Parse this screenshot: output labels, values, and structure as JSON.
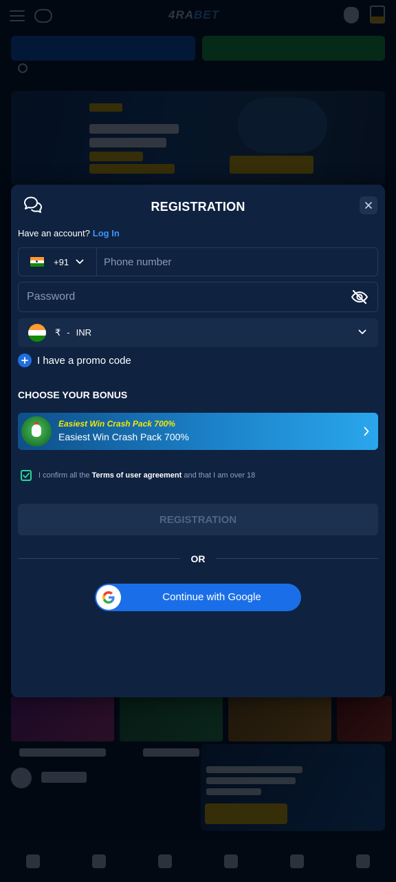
{
  "modal": {
    "title": "REGISTRATION",
    "account_prompt": "Have an account?",
    "login_link": "Log In",
    "phone": {
      "dial_code": "+91",
      "placeholder": "Phone number",
      "value": ""
    },
    "password": {
      "placeholder": "Password",
      "value": ""
    },
    "currency": {
      "symbol": "₹",
      "separator": "-",
      "code": "INR"
    },
    "promo_label": "I have a promo code",
    "bonus_heading": "CHOOSE YOUR BONUS",
    "bonus": {
      "title": "Easiest Win Crash Pack 700%",
      "subtitle": "Easiest Win Crash Pack 700%"
    },
    "terms": {
      "checked": true,
      "prefix": "I confirm all the",
      "link": "Terms of user agreement",
      "suffix": "and that I am over 18"
    },
    "register_button": "REGISTRATION",
    "divider_text": "OR",
    "google_button": "Continue with Google"
  },
  "icons": {
    "chat": "chat-bubbles-icon",
    "close": "close-icon",
    "flag": "india-flag-icon",
    "chevron": "chevron-down-icon",
    "eye": "eye-off-icon",
    "plus": "plus-icon",
    "arrow": "chevron-right-icon",
    "check": "checkmark-icon",
    "google": "google-logo-icon"
  },
  "colors": {
    "modal_bg": "#0f2240",
    "accent_blue": "#1a6fe8",
    "link_blue": "#3d94ff",
    "check_green": "#27d69a",
    "bonus_title_yellow": "#f5e800",
    "disabled_text": "#4e6585"
  }
}
